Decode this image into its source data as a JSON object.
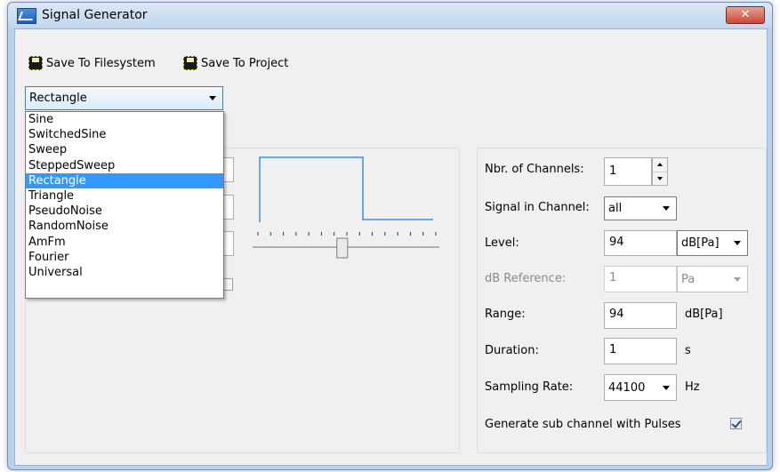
{
  "window": {
    "title": "Signal Generator",
    "close_glyph": "✕"
  },
  "toolbar": {
    "save_fs": "Save To Filesystem",
    "save_project": "Save To Project",
    "icon": "floppy-disk-icon"
  },
  "signal_type": {
    "selected": "Rectangle",
    "options": [
      "Sine",
      "SwitchedSine",
      "Sweep",
      "SteppedSweep",
      "Rectangle",
      "Triangle",
      "PseudoNoise",
      "RandomNoise",
      "AmFm",
      "Fourier",
      "Universal"
    ],
    "selected_index": 4
  },
  "preview": {
    "slider_fraction": 0.48,
    "tick_count": 15
  },
  "right": {
    "channels_label": "Nbr. of Channels:",
    "channels_value": "1",
    "signal_in_channel_label": "Signal in Channel:",
    "signal_in_channel_value": "all",
    "level_label": "Level:",
    "level_value": "94",
    "level_unit": "dB[Pa]",
    "dbref_label": "dB Reference:",
    "dbref_value": "1",
    "dbref_unit": "Pa",
    "range_label": "Range:",
    "range_value": "94",
    "range_unit": "dB[Pa]",
    "duration_label": "Duration:",
    "duration_value": "1",
    "duration_unit": "s",
    "sampling_label": "Sampling Rate:",
    "sampling_value": "44100",
    "sampling_unit": "Hz",
    "subchannel_label": "Generate sub channel with Pulses",
    "subchannel_checked": true
  },
  "colors": {
    "accent": "#3399ff",
    "waveform": "#3a8ee6",
    "window_frame": "#b9d1ea",
    "close": "#c9483a"
  }
}
